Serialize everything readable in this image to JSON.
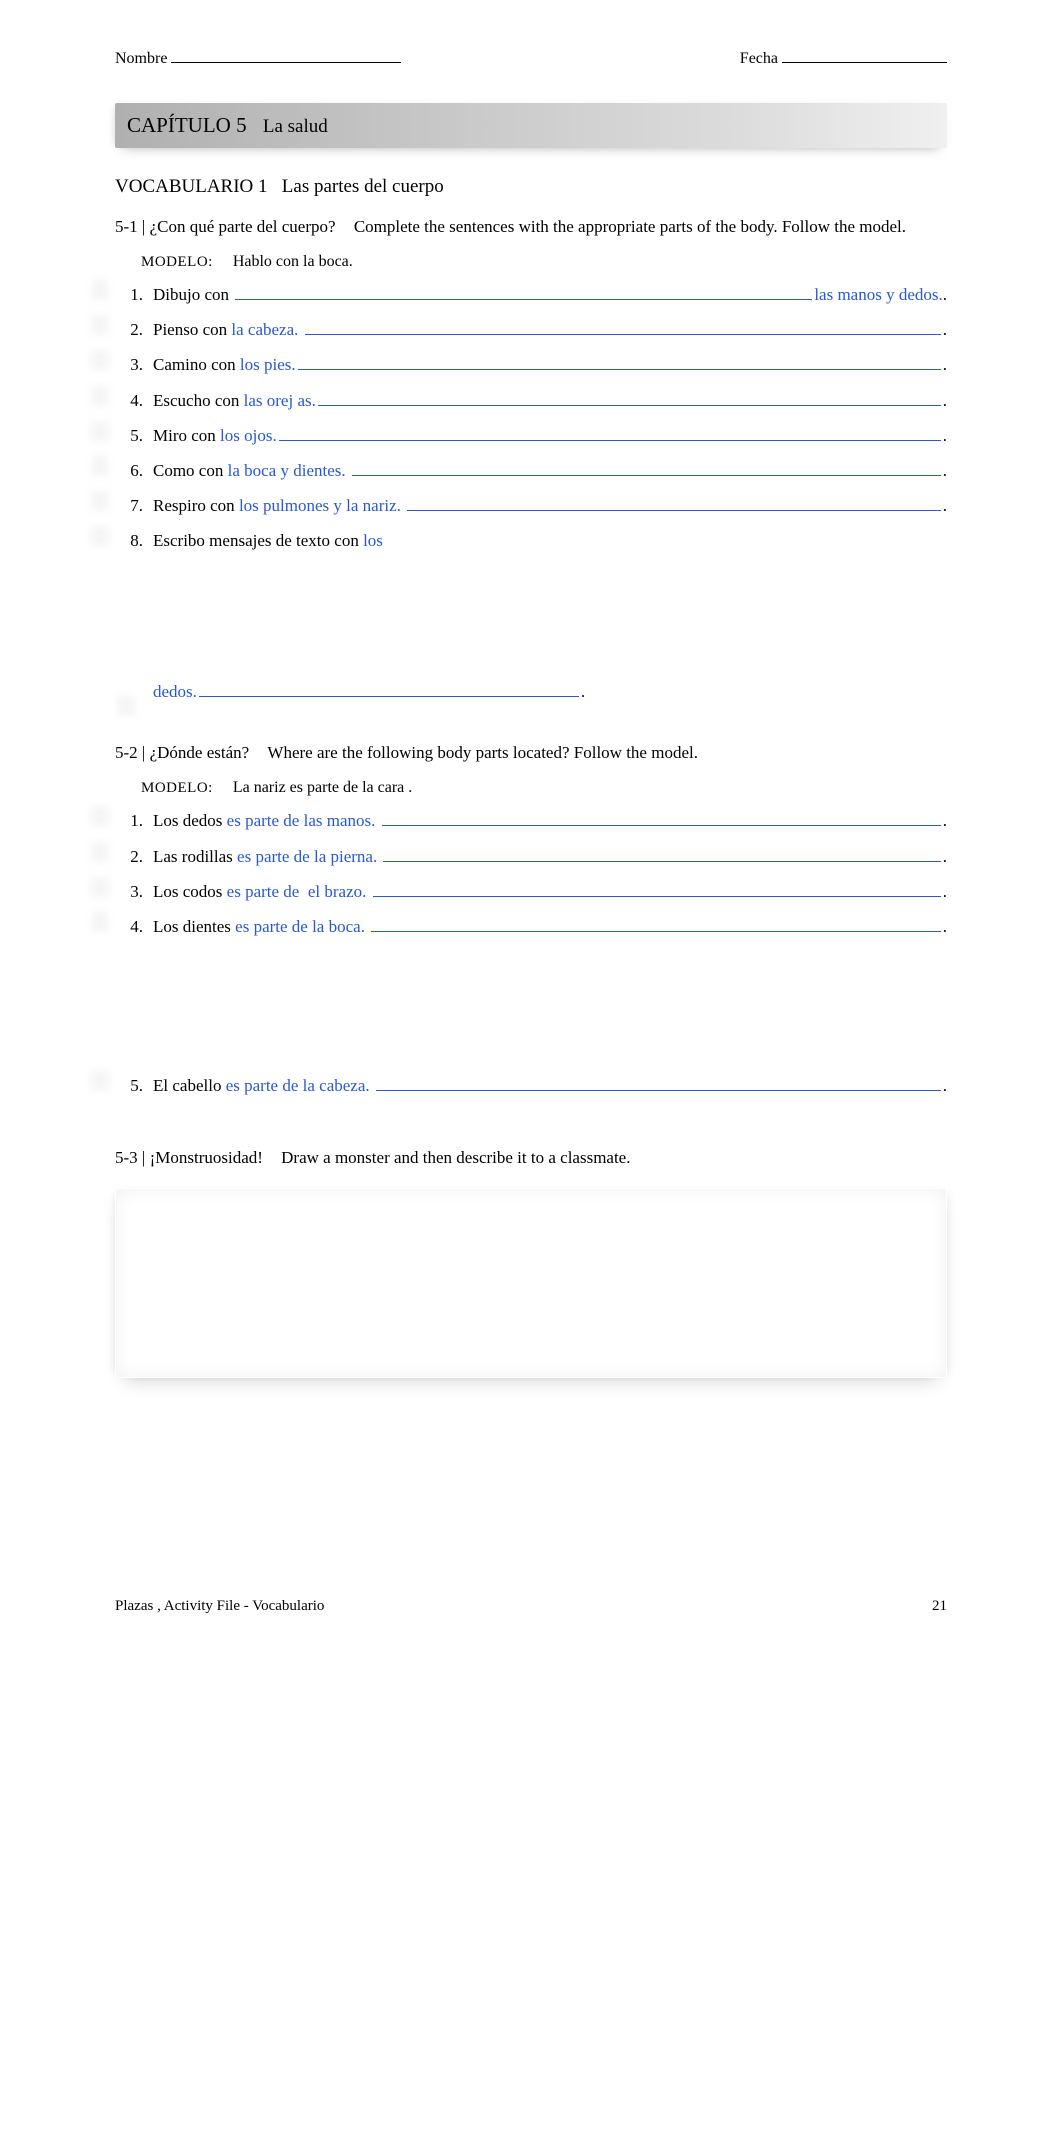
{
  "header": {
    "name_label": "Nombre",
    "date_label": "Fecha"
  },
  "chapter": {
    "number": "CAPÍTULO 5",
    "title": "La salud"
  },
  "vocab_heading": {
    "num": "VOCABULARIO 1",
    "title": "Las partes del cuerpo"
  },
  "ex1": {
    "code": "5-1",
    "title": "¿Con qué parte del cuerpo?",
    "instr": "Complete the sentences with the appropriate parts of the body. Follow the model.",
    "modelo_label": "MODELO:",
    "modelo_text": "Hablo con la boca.",
    "items": [
      {
        "n": "1.",
        "prompt": "Dibujo con ",
        "answer_after": "las manos y dedos.",
        "period": " ."
      },
      {
        "n": "2.",
        "prompt": "Pienso con ",
        "answer_before": "la cabeza. ",
        "period": "."
      },
      {
        "n": "3.",
        "prompt": "Camino con ",
        "answer_before": "los pies.",
        "period": "."
      },
      {
        "n": "4.",
        "prompt": "Escucho con ",
        "answer_before": "las orej as.",
        "period": "."
      },
      {
        "n": "5.",
        "prompt": "Miro con ",
        "answer_before": "los ojos.",
        "period": "."
      },
      {
        "n": "6.",
        "prompt": "Como con ",
        "answer_before": "la boca y dientes. ",
        "period": "."
      },
      {
        "n": "7.",
        "prompt": "Respiro con ",
        "answer_before": "los pulmones y la nariz. ",
        "period": "."
      },
      {
        "n": "8.",
        "prompt": "Escribo mensajes de texto con ",
        "answer_inline": "los"
      }
    ],
    "continuation": {
      "answer": "dedos.",
      "period": " ."
    }
  },
  "ex2": {
    "code": "5-2",
    "title": "¿Dónde están?",
    "instr": "Where are the following body parts located? Follow the model.",
    "modelo_label": "MODELO:",
    "modelo_text": "La nariz es parte de la cara .",
    "items": [
      {
        "n": "1.",
        "prompt": "Los dedos ",
        "answer": "es parte de las manos. ",
        "period": "."
      },
      {
        "n": "2.",
        "prompt": "Las rodillas ",
        "answer": "es parte de la pierna. ",
        "period": "."
      },
      {
        "n": "3.",
        "prompt": "Los codos ",
        "answer": "es parte de  el brazo. ",
        "period": "."
      },
      {
        "n": "4.",
        "prompt": "Los dientes ",
        "answer": "es parte de la boca. ",
        "period": "."
      }
    ],
    "item5": {
      "n": "5.",
      "prompt": "El cabello ",
      "answer": "es parte de la cabeza. ",
      "period": "."
    }
  },
  "ex3": {
    "code": "5-3",
    "title": "¡Monstruosidad!",
    "instr": "Draw a monster and then describe it to a classmate."
  },
  "footer": {
    "left": "Plazas , Activity File - Vocabulario",
    "right": "21"
  }
}
